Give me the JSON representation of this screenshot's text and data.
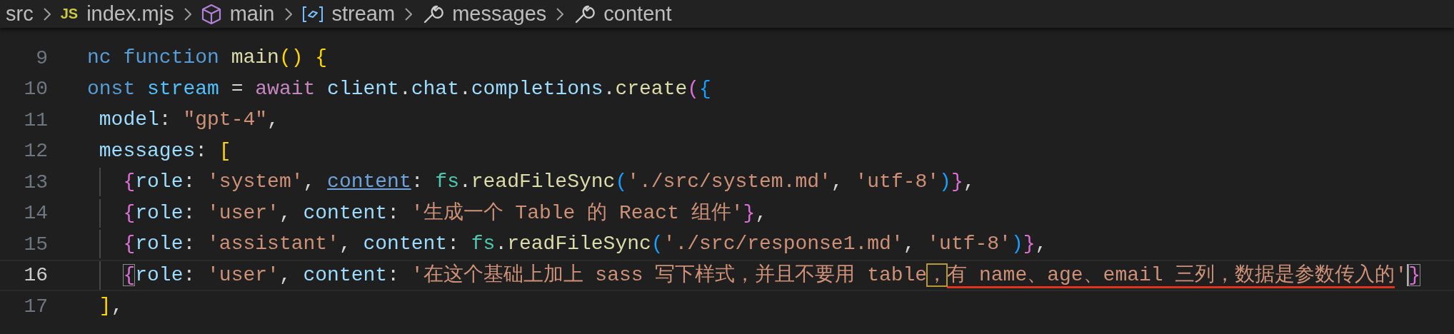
{
  "breadcrumbs": [
    {
      "label": "src",
      "kind": "folder"
    },
    {
      "label": "index.mjs",
      "kind": "file",
      "badge": "JS"
    },
    {
      "label": "main",
      "kind": "module"
    },
    {
      "label": "stream",
      "kind": "variable"
    },
    {
      "label": "messages",
      "kind": "property"
    },
    {
      "label": "content",
      "kind": "property"
    }
  ],
  "lines": [
    {
      "number": "9",
      "active": false,
      "tokens": [
        {
          "text": "nc",
          "kind": "keyword"
        },
        {
          "text": " function",
          "kind": "keyword"
        },
        {
          "text": " main",
          "kind": "function"
        },
        {
          "text": "()",
          "kind": "bracket1"
        },
        {
          "text": " {",
          "kind": "bracket1"
        }
      ]
    },
    {
      "number": "10",
      "active": false,
      "tokens": [
        {
          "text": "onst",
          "kind": "keyword"
        },
        {
          "text": " stream",
          "kind": "constant"
        },
        {
          "text": " = ",
          "kind": "plain"
        },
        {
          "text": "await",
          "kind": "control"
        },
        {
          "text": " client",
          "kind": "variable"
        },
        {
          "text": ".",
          "kind": "plain"
        },
        {
          "text": "chat",
          "kind": "variable"
        },
        {
          "text": ".",
          "kind": "plain"
        },
        {
          "text": "completions",
          "kind": "variable"
        },
        {
          "text": ".",
          "kind": "plain"
        },
        {
          "text": "create",
          "kind": "function"
        },
        {
          "text": "(",
          "kind": "bracket2"
        },
        {
          "text": "{",
          "kind": "bracket3"
        }
      ]
    },
    {
      "number": "11",
      "active": false,
      "tokens": [
        {
          "text": " model",
          "kind": "property"
        },
        {
          "text": ": ",
          "kind": "plain"
        },
        {
          "text": "\"gpt-4\"",
          "kind": "string"
        },
        {
          "text": ",",
          "kind": "plain"
        }
      ]
    },
    {
      "number": "12",
      "active": false,
      "tokens": [
        {
          "text": " messages",
          "kind": "property"
        },
        {
          "text": ": ",
          "kind": "plain"
        },
        {
          "text": "[",
          "kind": "bracket1"
        }
      ]
    },
    {
      "number": "13",
      "active": false,
      "tokens": [
        {
          "text": "   {",
          "kind": "bracket2"
        },
        {
          "text": "role",
          "kind": "property"
        },
        {
          "text": ": ",
          "kind": "plain"
        },
        {
          "text": "'system'",
          "kind": "string"
        },
        {
          "text": ", ",
          "kind": "plain"
        },
        {
          "text": "content",
          "kind": "link"
        },
        {
          "text": ": ",
          "kind": "plain"
        },
        {
          "text": "fs",
          "kind": "namespace"
        },
        {
          "text": ".",
          "kind": "plain"
        },
        {
          "text": "readFileSync",
          "kind": "function"
        },
        {
          "text": "(",
          "kind": "bracket3"
        },
        {
          "text": "'./src/system.md'",
          "kind": "string"
        },
        {
          "text": ", ",
          "kind": "plain"
        },
        {
          "text": "'utf-8'",
          "kind": "string"
        },
        {
          "text": ")",
          "kind": "bracket3"
        },
        {
          "text": "}",
          "kind": "bracket2"
        },
        {
          "text": ",",
          "kind": "plain"
        }
      ]
    },
    {
      "number": "14",
      "active": false,
      "tokens": [
        {
          "text": "   {",
          "kind": "bracket2"
        },
        {
          "text": "role",
          "kind": "property"
        },
        {
          "text": ": ",
          "kind": "plain"
        },
        {
          "text": "'user'",
          "kind": "string"
        },
        {
          "text": ", ",
          "kind": "plain"
        },
        {
          "text": "content",
          "kind": "property"
        },
        {
          "text": ": ",
          "kind": "plain"
        },
        {
          "text": "'生成一个 Table 的 React 组件'",
          "kind": "string"
        },
        {
          "text": "}",
          "kind": "bracket2"
        },
        {
          "text": ",",
          "kind": "plain"
        }
      ]
    },
    {
      "number": "15",
      "active": false,
      "tokens": [
        {
          "text": "   {",
          "kind": "bracket2"
        },
        {
          "text": "role",
          "kind": "property"
        },
        {
          "text": ": ",
          "kind": "plain"
        },
        {
          "text": "'assistant'",
          "kind": "string"
        },
        {
          "text": ", ",
          "kind": "plain"
        },
        {
          "text": "content",
          "kind": "property"
        },
        {
          "text": ": ",
          "kind": "plain"
        },
        {
          "text": "fs",
          "kind": "namespace"
        },
        {
          "text": ".",
          "kind": "plain"
        },
        {
          "text": "readFileSync",
          "kind": "function"
        },
        {
          "text": "(",
          "kind": "bracket3"
        },
        {
          "text": "'./src/response1.md'",
          "kind": "string"
        },
        {
          "text": ", ",
          "kind": "plain"
        },
        {
          "text": "'utf-8'",
          "kind": "string"
        },
        {
          "text": ")",
          "kind": "bracket3"
        },
        {
          "text": "}",
          "kind": "bracket2"
        },
        {
          "text": ",",
          "kind": "plain"
        }
      ]
    },
    {
      "number": "16",
      "active": true,
      "tokens": [
        {
          "text": "   {",
          "kind": "bracket2",
          "bracket_match": true,
          "find_match": false,
          "underlined": false,
          "cursor": false
        },
        {
          "text": "role",
          "kind": "property",
          "bracket_match": false,
          "find_match": false,
          "underlined": false,
          "cursor": false
        },
        {
          "text": ": ",
          "kind": "plain",
          "bracket_match": false,
          "find_match": false,
          "underlined": false,
          "cursor": false
        },
        {
          "text": "'user'",
          "kind": "string",
          "bracket_match": false,
          "find_match": false,
          "underlined": false,
          "cursor": false
        },
        {
          "text": ", ",
          "kind": "plain",
          "bracket_match": false,
          "find_match": false,
          "underlined": false,
          "cursor": false
        },
        {
          "text": "content",
          "kind": "property",
          "bracket_match": false,
          "find_match": false,
          "underlined": false,
          "cursor": false
        },
        {
          "text": ": ",
          "kind": "plain",
          "bracket_match": false,
          "find_match": false,
          "underlined": false,
          "cursor": false
        },
        {
          "text": "'在这个基础上加上 sass 写下样式，并且不要用 table",
          "kind": "string",
          "bracket_match": false,
          "find_match": false,
          "underlined": false,
          "cursor": false
        },
        {
          "text": "，",
          "kind": "string",
          "bracket_match": false,
          "find_match": true,
          "underlined": false,
          "cursor": false
        },
        {
          "text": "有 name、age、email 三列，数据是参数传入的",
          "kind": "string",
          "bracket_match": false,
          "find_match": false,
          "underlined": true,
          "cursor": false
        },
        {
          "text": "'",
          "kind": "string",
          "bracket_match": false,
          "find_match": false,
          "underlined": false,
          "cursor": true
        },
        {
          "text": "}",
          "kind": "bracket2",
          "bracket_match": true,
          "find_match": false,
          "underlined": false,
          "cursor": false
        }
      ]
    },
    {
      "number": "17",
      "active": false,
      "tokens": [
        {
          "text": " ]",
          "kind": "bracket1"
        },
        {
          "text": ",",
          "kind": "plain"
        }
      ]
    }
  ]
}
